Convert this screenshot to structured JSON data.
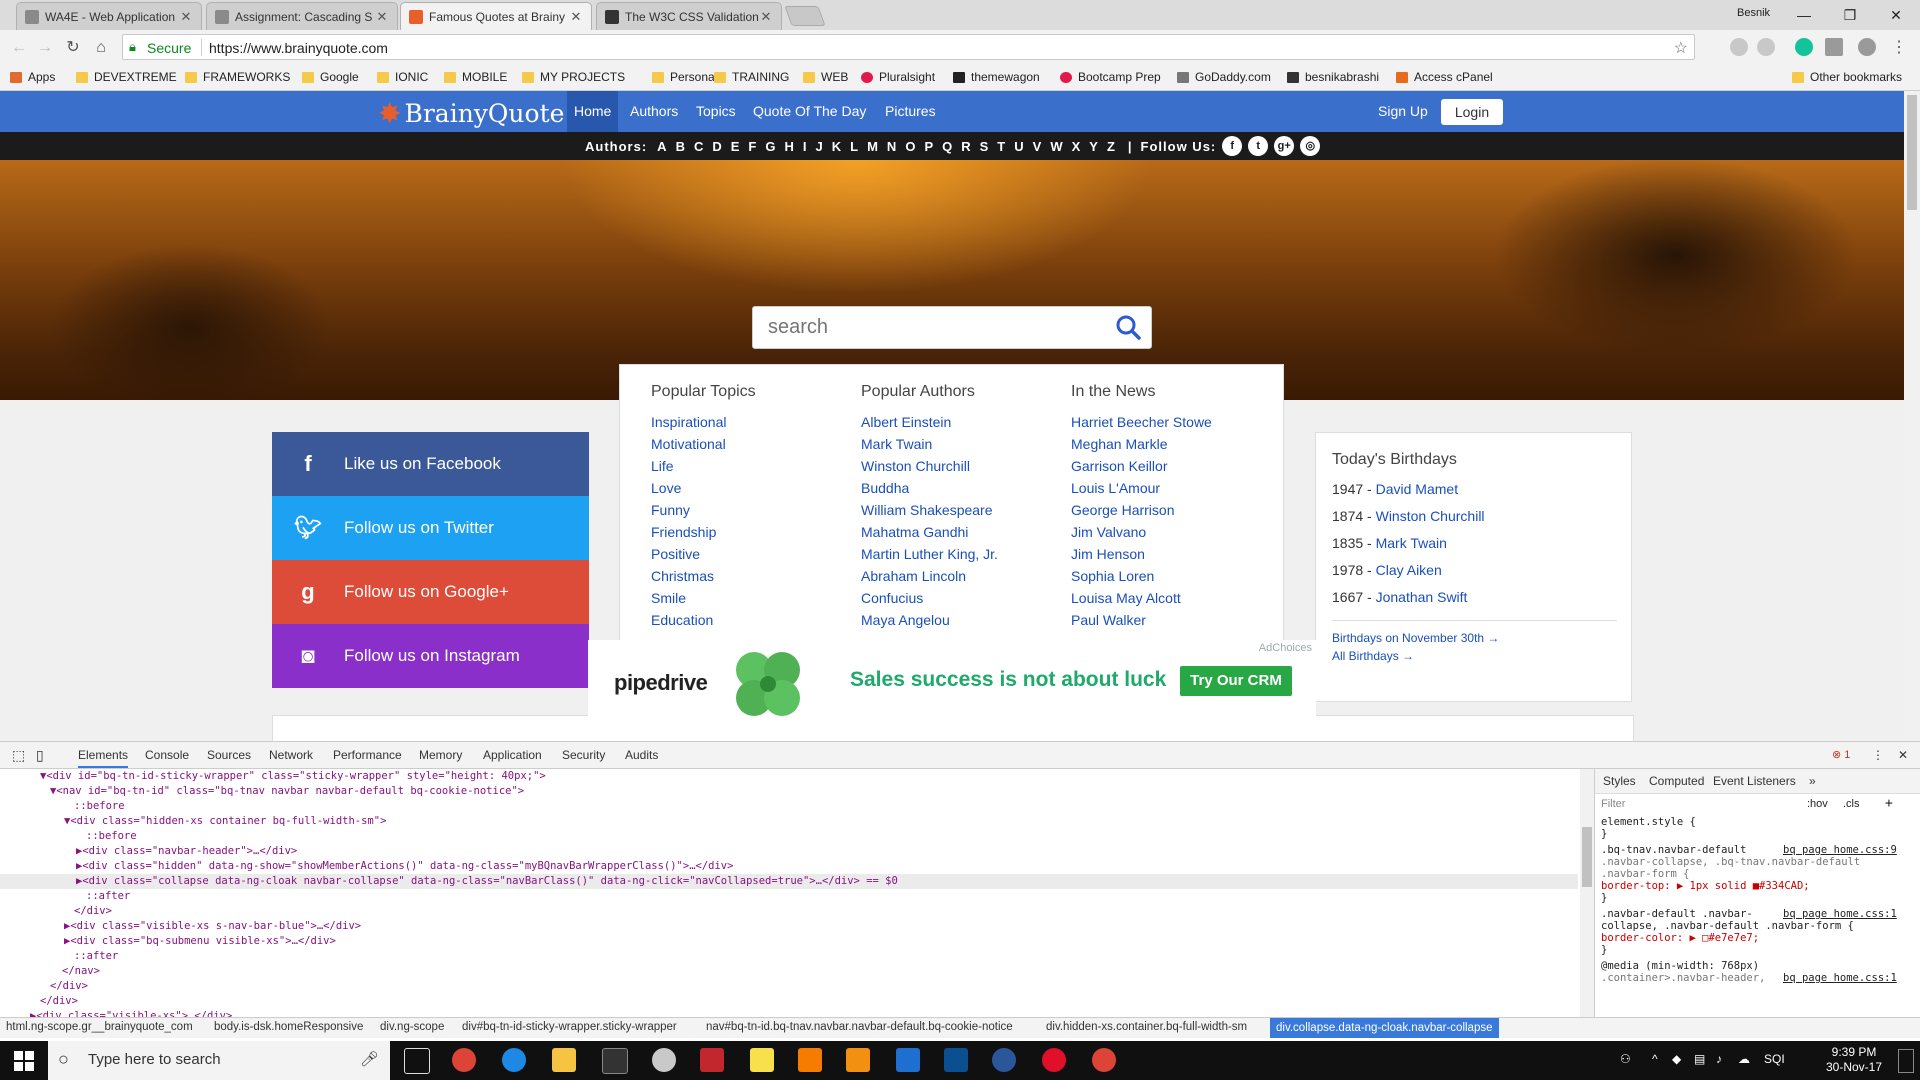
{
  "browser": {
    "tabs": [
      {
        "title": "WA4E - Web Application",
        "favicon_color": "#8a8a8a"
      },
      {
        "title": "Assignment: Cascading S",
        "favicon_color": "#8a8a8a"
      },
      {
        "title": "Famous Quotes at Brainy",
        "favicon_color": "#e85f2b"
      },
      {
        "title": "The W3C CSS Validation",
        "favicon_color": "#333333"
      }
    ],
    "profile": "Besnik",
    "secure_label": "Secure",
    "url": "https://www.brainyquote.com",
    "bookmarks": [
      "Apps",
      "DEVEXTREME",
      "FRAMEWORKS",
      "Google",
      "IONIC",
      "MOBILE",
      "MY PROJECTS",
      "Personal",
      "TRAINING",
      "WEB",
      "Pluralsight",
      "themewagon",
      "Bootcamp Prep",
      "GoDaddy.com",
      "besnikabrashi",
      "Access cPanel",
      "Other bookmarks"
    ]
  },
  "site": {
    "logo": "BrainyQuote",
    "nav": [
      "Home",
      "Authors",
      "Topics",
      "Quote Of The Day",
      "Pictures"
    ],
    "signup": "Sign Up",
    "login": "Login",
    "authors_label": "Authors:",
    "letters": [
      "A",
      "B",
      "C",
      "D",
      "E",
      "F",
      "G",
      "H",
      "I",
      "J",
      "K",
      "L",
      "M",
      "N",
      "O",
      "P",
      "Q",
      "R",
      "S",
      "T",
      "U",
      "V",
      "W",
      "X",
      "Y",
      "Z"
    ],
    "follow_label": "Follow Us:",
    "search_placeholder": "search",
    "popular_topics": {
      "heading": "Popular Topics",
      "items": [
        "Inspirational",
        "Motivational",
        "Life",
        "Love",
        "Funny",
        "Friendship",
        "Positive",
        "Christmas",
        "Smile",
        "Education"
      ]
    },
    "popular_authors": {
      "heading": "Popular Authors",
      "items": [
        "Albert Einstein",
        "Mark Twain",
        "Winston Churchill",
        "Buddha",
        "William Shakespeare",
        "Mahatma Gandhi",
        "Martin Luther King, Jr.",
        "Abraham Lincoln",
        "Confucius",
        "Maya Angelou"
      ]
    },
    "in_the_news": {
      "heading": "In the News",
      "items": [
        "Harriet Beecher Stowe",
        "Meghan Markle",
        "Garrison Keillor",
        "Louis L'Amour",
        "George Harrison",
        "Jim Valvano",
        "Jim Henson",
        "Sophia Loren",
        "Louisa May Alcott",
        "Paul Walker"
      ]
    },
    "social": [
      {
        "label": "Like us on Facebook",
        "icon": "f",
        "color": "#3b5998"
      },
      {
        "label": "Follow us on Twitter",
        "icon": "t",
        "color": "#1da1f2"
      },
      {
        "label": "Follow us on Google+",
        "icon": "g",
        "color": "#dd4b39"
      },
      {
        "label": "Follow us on Instagram",
        "icon": "i",
        "color": "#8a2fc9"
      }
    ],
    "birthdays": {
      "heading": "Today's Birthdays",
      "items": [
        {
          "year": "1947",
          "name": "David Mamet"
        },
        {
          "year": "1874",
          "name": "Winston Churchill"
        },
        {
          "year": "1835",
          "name": "Mark Twain"
        },
        {
          "year": "1978",
          "name": "Clay Aiken"
        },
        {
          "year": "1667",
          "name": "Jonathan Swift"
        }
      ],
      "on_date_link": "Birthdays on November 30th →",
      "all_link": "All Birthdays →"
    },
    "ad": {
      "adchoices": "AdChoices",
      "brand": "pipedrive",
      "slogan": "Sales success is not about luck",
      "cta": "Try Our CRM"
    }
  },
  "devtools": {
    "tabs": [
      "Elements",
      "Console",
      "Sources",
      "Network",
      "Performance",
      "Memory",
      "Application",
      "Security",
      "Audits"
    ],
    "error_count": "1",
    "dom_lines": [
      {
        "t": "▼<div id=\"bq-tn-id-sticky-wrapper\" class=\"sticky-wrapper\" style=\"height: 40px;\">"
      },
      {
        "t": "▼<nav id=\"bq-tn-id\" class=\"bq-tnav navbar navbar-default bq-cookie-notice\">"
      },
      {
        "t": "::before"
      },
      {
        "t": "▼<div class=\"hidden-xs container bq-full-width-sm\">"
      },
      {
        "t": "::before"
      },
      {
        "t": "▶<div class=\"navbar-header\">…</div>"
      },
      {
        "t": "▶<div class=\"hidden\" data-ng-show=\"showMemberActions()\" data-ng-class=\"myBQnavBarWrapperClass()\">…</div>"
      },
      {
        "t": "▶<div class=\"collapse data-ng-cloak navbar-collapse\" data-ng-class=\"navBarClass()\" data-ng-click=\"navCollapsed=true\">…</div> == $0"
      },
      {
        "t": "::after"
      },
      {
        "t": "</div>"
      },
      {
        "t": "▶<div class=\"visible-xs s-nav-bar-blue\">…</div>"
      },
      {
        "t": "▶<div class=\"bq-submenu visible-xs\">…</div>"
      },
      {
        "t": "::after"
      },
      {
        "t": "</nav>"
      },
      {
        "t": "</div>"
      },
      {
        "t": "</div>"
      },
      {
        "t": "▶<div class=\"visible-xs\">…</div>"
      }
    ],
    "styles_tabs": [
      "Styles",
      "Computed",
      "Event Listeners"
    ],
    "filter_placeholder": "Filter",
    "hov": ":hov",
    "cls": ".cls",
    "style_lines": [
      "element.style {",
      "}",
      ".bq-tnav.navbar-default",
      ".navbar-collapse, .bq-tnav.navbar-default",
      ".navbar-form {",
      "  border-top: ▶ 1px solid ■#334CAD;",
      "}",
      ".navbar-default .navbar-",
      "collapse, .navbar-default .navbar-form {",
      "  border-color: ▶ □#e7e7e7;",
      "}",
      "@media (min-width: 768px)",
      ".container>.navbar-header,"
    ],
    "style_sources": [
      "bq page home.css:9",
      "bq page home.css:1",
      "bq page home.css:1"
    ],
    "breadcrumbs": [
      "html.ng-scope.gr__brainyquote_com",
      "body.is-dsk.homeResponsive",
      "div.ng-scope",
      "div#bq-tn-id-sticky-wrapper.sticky-wrapper",
      "nav#bq-tn-id.bq-tnav.navbar.navbar-default.bq-cookie-notice",
      "div.hidden-xs.container.bq-full-width-sm",
      "div.collapse.data-ng-cloak.navbar-collapse"
    ]
  },
  "taskbar": {
    "search_placeholder": "Type here to search",
    "language": "SQI",
    "time": "9:39 PM",
    "date": "30-Nov-17"
  }
}
